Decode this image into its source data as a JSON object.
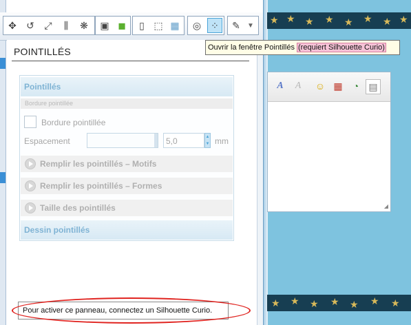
{
  "panel": {
    "title": "POINTILLÉS",
    "section_title": "Pointillés",
    "sub_header": "Bordure pointillée",
    "checkbox_label": "Bordure pointillée",
    "spacing_label": "Espacement",
    "spacing_value": "5,0",
    "spacing_unit": "mm",
    "fill_motifs": "Remplir les pointillés – Motifs",
    "fill_formes": "Remplir les pointillés – Formes",
    "dot_size": "Taille des pointillés",
    "drawing_section": "Dessin pointillés",
    "status_message": "Pour activer ce panneau, connectez un Silhouette Curio."
  },
  "tooltip": {
    "text": "Ouvrir la fenêtre Pointillés",
    "highlight": "(requiert Silhouette Curio)"
  },
  "toolbar_icons": [
    "move-icon",
    "rotate-icon",
    "scale-icon",
    "align-icon",
    "replicate-icon",
    "library-icon",
    "fill-icon",
    "page-icon",
    "crop-icon",
    "grid-icon",
    "spiral-icon",
    "dots-icon",
    "pen-icon",
    "dropdown-icon"
  ],
  "colors": {
    "accent": "#4aa4d8",
    "annotation": "#e0231f",
    "background_right": "#7ec3df"
  }
}
